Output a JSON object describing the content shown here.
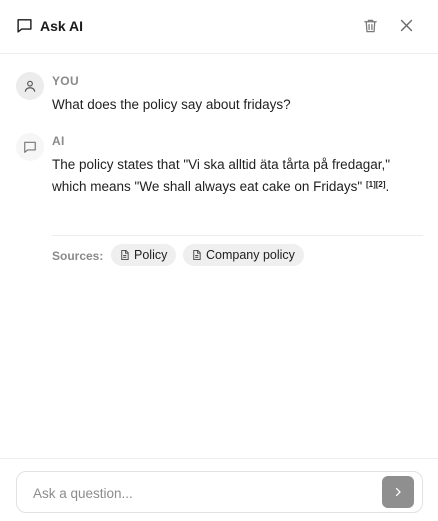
{
  "header": {
    "title": "Ask AI",
    "title_icon": "chat-bubble-icon",
    "actions": [
      {
        "icon": "trash-icon"
      },
      {
        "icon": "close-icon"
      }
    ]
  },
  "messages": [
    {
      "role": "YOU",
      "avatar_icon": "user-icon",
      "text": "What does the policy say about fridays?"
    },
    {
      "role": "AI",
      "avatar_icon": "chat-bubble-icon",
      "text": "The policy states that \"Vi ska alltid äta tårta på fredagar,\" which means \"We shall always eat cake on Fridays\"",
      "citations": "[1][2]",
      "end_punctuation": "."
    }
  ],
  "sources": {
    "label": "Sources:",
    "items": [
      {
        "label": "Policy",
        "icon": "document-icon"
      },
      {
        "label": "Company policy",
        "icon": "document-icon"
      }
    ]
  },
  "composer": {
    "placeholder": "Ask a question...",
    "value": "",
    "send_icon": "chevron-right-icon"
  },
  "colors": {
    "muted_text": "#8a8a8a",
    "send_button": "#8f8f8f",
    "chip_bg": "#efefef",
    "avatar_bg": "#ececec"
  }
}
